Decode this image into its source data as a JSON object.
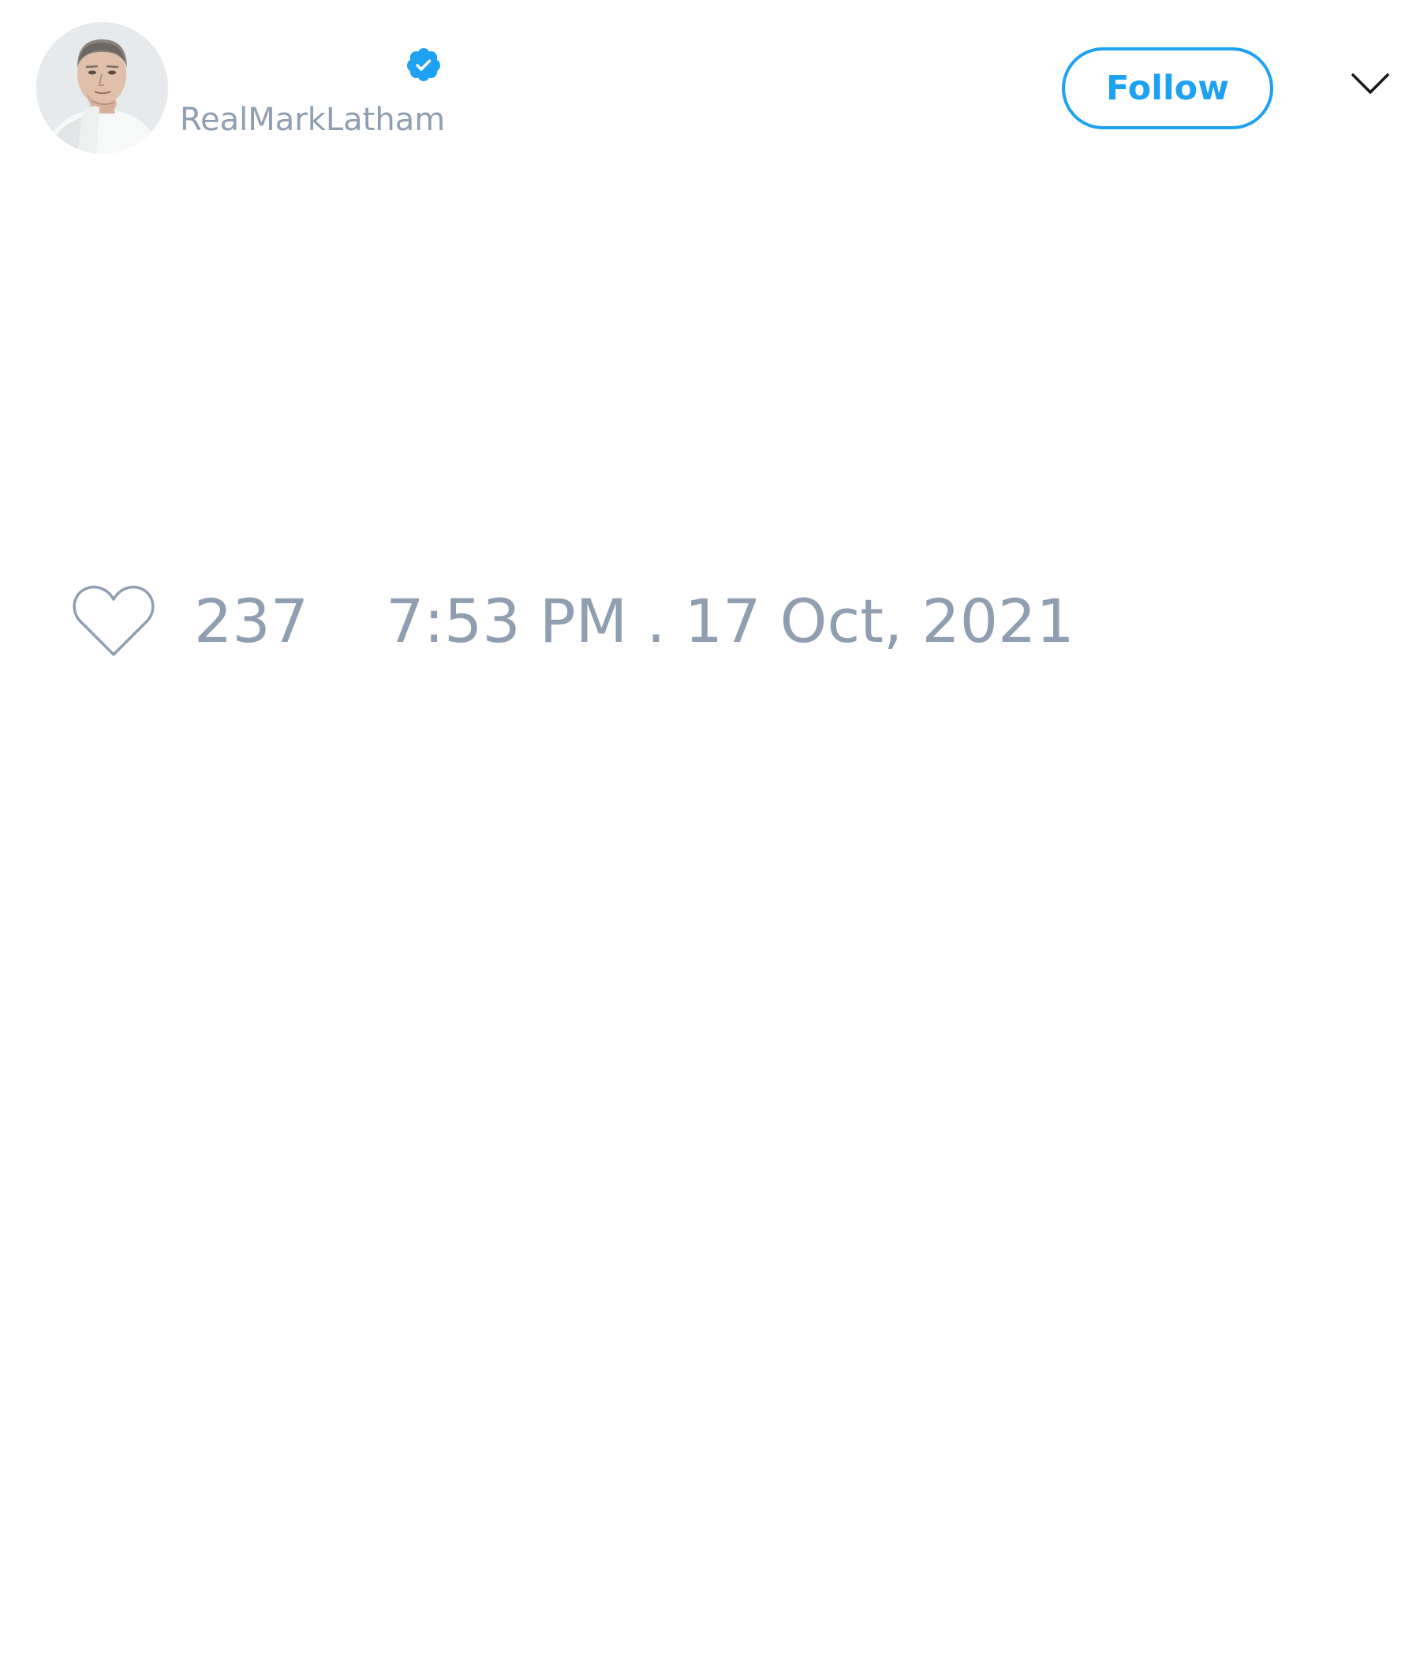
{
  "tweet": {
    "author": {
      "display_name": "",
      "handle": "RealMarkLatham",
      "verified": true,
      "verified_icon": "verified-badge-icon",
      "avatar": "profile-photo"
    },
    "follow_label": "Follow",
    "menu_icon": "chevron-down-icon",
    "like_icon": "heart-icon",
    "like_count": "237",
    "timestamp": "7:53 PM . 17 Oct, 2021"
  },
  "colors": {
    "accent": "#1da1f2",
    "muted_text": "#8f9eb1",
    "background": "#ffffff"
  }
}
